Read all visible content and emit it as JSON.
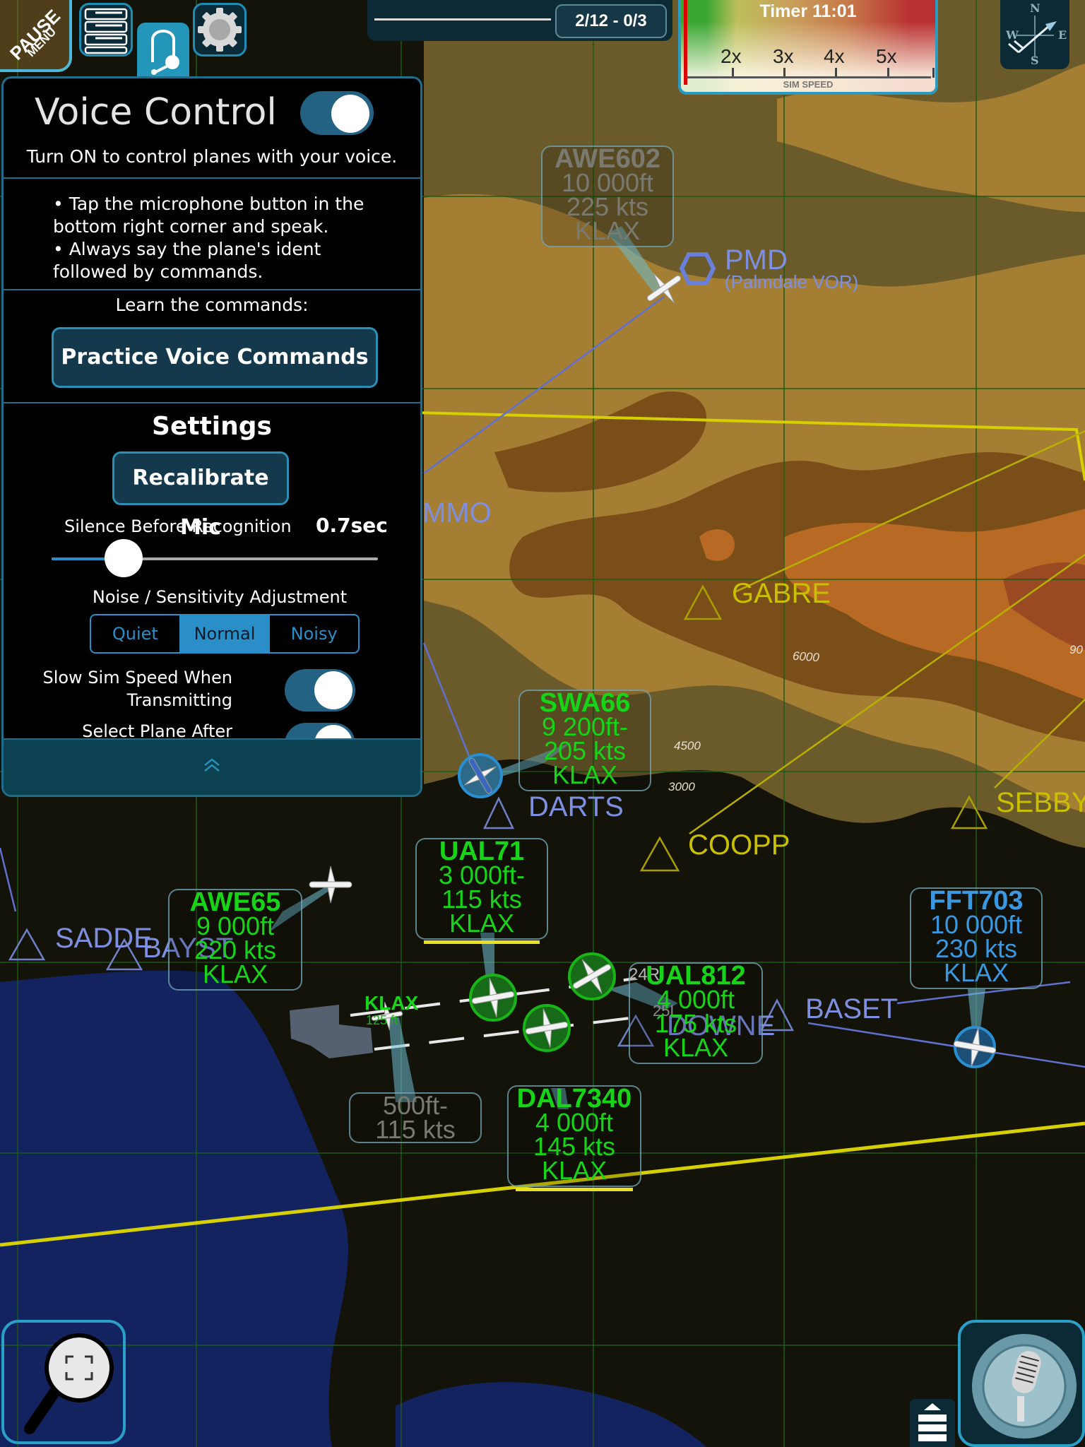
{
  "top_bar": {
    "pause_menu": {
      "line1": "PAUSE",
      "line2": "MENU"
    },
    "icons": [
      "flight-strips-icon",
      "headset-icon",
      "gear-icon"
    ],
    "wave_badge": "2/12 - 0/3",
    "progress": 1.0
  },
  "sim_speed": {
    "timer": "Timer 11:01",
    "ticks": [
      "2x",
      "3x",
      "4x",
      "5x"
    ],
    "label": "SIM SPEED",
    "current_multiplier": 1
  },
  "compass": {
    "n": "N",
    "s": "S",
    "e": "E",
    "w": "W",
    "wind_icon": "wind-barb-icon"
  },
  "voice_panel": {
    "title": "Voice Control",
    "enabled": true,
    "subtitle": "Turn ON to control planes with your voice.",
    "bullets": [
      "• Tap the microphone button in the",
      "bottom right corner and speak.",
      "• Always say the plane's ident",
      "followed by commands."
    ],
    "learn_label": "Learn the commands:",
    "practice_button": "Practice Voice Commands",
    "settings_title": "Settings",
    "recalibrate_button": "Recalibrate Mic",
    "silence_label": "Silence Before Recognition",
    "silence_value": "0.7sec",
    "silence_slider_fraction": 0.22,
    "noise_label": "Noise / Sensitivity Adjustment",
    "noise_options": [
      "Quiet",
      "Normal",
      "Noisy"
    ],
    "noise_selected": "Normal",
    "slow_sim_label_1": "Slow Sim Speed When",
    "slow_sim_label_2": "Transmitting",
    "slow_sim_enabled": true,
    "select_plane_label": "Select Plane After",
    "select_plane_enabled": true
  },
  "map": {
    "waypoints_blue": [
      "PMD",
      "MMO",
      "DARTS",
      "SADDE",
      "BAYST",
      "DOWNE",
      "BASET"
    ],
    "vor_subtitle": "(Palmdale VOR)",
    "waypoints_yellow": [
      "GABRE",
      "COOPP",
      "SEBBY"
    ],
    "contours": [
      "6000",
      "4500",
      "3000",
      "90"
    ],
    "airport": {
      "code": "KLAX",
      "elevation": "125 ft",
      "runways": [
        "24R",
        "25L"
      ]
    },
    "aircraft": [
      {
        "callsign": "AWE602",
        "altitude": "10 000ft",
        "speed": "225 kts",
        "dest": "KLAX",
        "state": "inactive"
      },
      {
        "callsign": "SWA66",
        "altitude": "9 200ft-",
        "speed": "205 kts",
        "dest": "KLAX",
        "state": "selected"
      },
      {
        "callsign": "UAL71",
        "altitude": "3 000ft-",
        "speed": "115 kts",
        "dest": "KLAX",
        "state": "landing"
      },
      {
        "callsign": "AWE65",
        "altitude": "9 000ft",
        "speed": "220 kts",
        "dest": "KLAX",
        "state": "active"
      },
      {
        "callsign": "UAL812",
        "altitude": "4 000ft",
        "speed": "175 kts",
        "dest": "KLAX",
        "state": "landing"
      },
      {
        "callsign": "DAL7340",
        "altitude": "4 000ft",
        "speed": "145 kts",
        "dest": "KLAX",
        "state": "landing"
      },
      {
        "callsign": "FFT703",
        "altitude": "10 000ft",
        "speed": "230 kts",
        "dest": "KLAX",
        "state": "handoff"
      },
      {
        "callsign": "",
        "altitude": "500ft-",
        "speed": "115 kts",
        "dest": "",
        "state": "departing"
      }
    ]
  },
  "bottom": {
    "zoom_icon": "magnifier-fit-icon",
    "mic_icon": "microphone-icon",
    "layers_icon": "layers-up-icon"
  }
}
